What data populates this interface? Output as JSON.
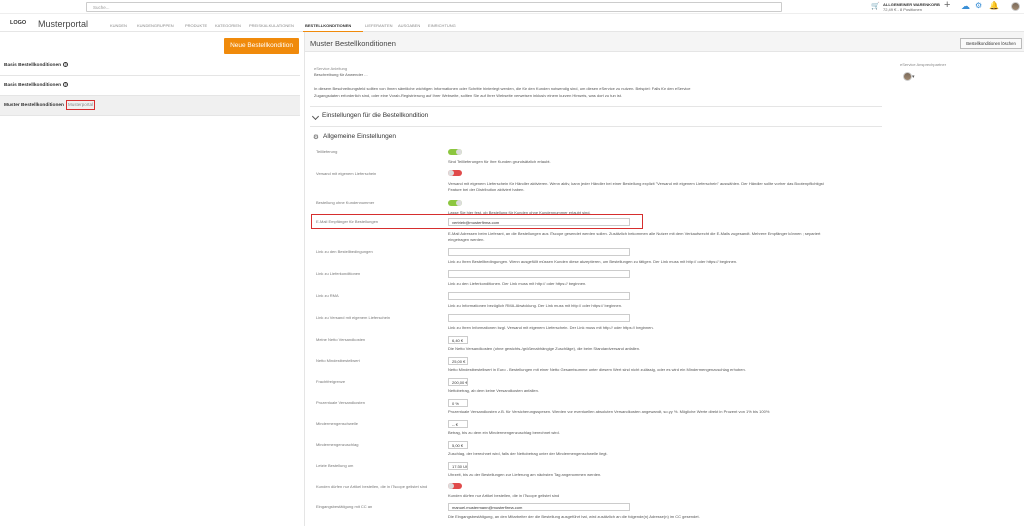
{
  "search": {
    "placeholder": "Suche..."
  },
  "cart": {
    "title": "ALLGEMEINER WARENKORB",
    "summary": "72,49 € - 8 Positionen"
  },
  "icons": {
    "cart": "cart-icon",
    "plus": "plus-icon",
    "bell": "bell-icon",
    "cloud": "cloud-icon"
  },
  "brand": {
    "logo": "LOGO",
    "portal": "Musterportal",
    "accent": "#f08a0b"
  },
  "nav": [
    "KUNDEN",
    "KUNDENGRUPPEN",
    "PRODUKTE",
    "KATEGORIEN",
    "PREISKALKULATIONEN",
    "BESTELLKONDITIONEN",
    "LIEFERANTEN",
    "AUSGABEN",
    "EINRICHTUNG"
  ],
  "left": {
    "new_button": "Neue Bestellkondition",
    "items": [
      {
        "label": "Basis Bestellkonditionen"
      },
      {
        "label": "Basis Bestellkonditionen"
      },
      {
        "label": "Muster Bestellkonditionen",
        "tag": "Musterportal"
      }
    ]
  },
  "right": {
    "title": "Muster Bestellkonditionen",
    "delete_button": "Bestellkonditionen löschen",
    "guide_label": "eService Anleitung",
    "guide_text": "Beschreibung für Anwender ...",
    "partner_label": "eService Ansprechpartner",
    "intro1": "In diesem Beschreibungsfeld sollten von Ihnen sämtliche wichtigen Informationen oder Schritte hinterlegt werden, die für den Kunden notwendig sind, um diesen eService zu nutzen. Beispiel: Falls für den eService",
    "intro2": "Zugangsdaten erforderlich sind, oder eine Vorab-Registrierung auf Ihrer Webseite, sollten Sie auf Ihrer Webseite verweisen inklusiv einem kurzen Hinweis, was dort zu tun ist.",
    "section": "Einstellungen für die Bestellkondition",
    "subsection": "Allgemeine Einstellungen"
  },
  "fields": {
    "teil_label": "Teillieferung",
    "teil_hint": "Sind Teillieferungen für Ihre Kunden grundsätzlich erlaubt.",
    "vers_label": "Versand mit eigenem Lieferschein",
    "vers_hint1": "Versand mit eigenem Lieferschein für Händler aktivieren. Wenn aktiv, kann jeder Händler bei einer Bestellung explizit \"Versand mit eigenem Lieferschein\" auswählen. Der Händler sollte vorher das Bootenpflichtigst",
    "vers_hint2": "Feature bei der Distribution aktiviert haben.",
    "ohne_label": "Bestellung ohne Kundennummer",
    "ohne_hint": "Lasse Sie hier fest, ob Bestellung für Kunden ohne Kundennummer erlaubt sind.",
    "mail_label": "E-Mail Empfänger für Bestellungen",
    "mail_value": "vertrieb@musterfirma.com",
    "mail_hint1": "E-Mail Adressen beim Lieferant, an die Bestellungen aus ITscope gesendet werden sollen. Zusätzlich bekommen alle Nutzer mit dem Verkaufsrecht die E-Mails zugesandt. Mehrere Empfänger können ; separiert",
    "mail_hint2": "eingetragen werden.",
    "link1_label": "Link zu den Bestellbedingungen",
    "link1_hint": "Link zu Ihren Bestellbedingungen. Wenn ausgefüllt müssen Kunden diese akzeptieren, um Bestellungen zu tätigen. Der Link muss mit http:// oder https:// beginnen.",
    "link2_label": "Link zu Lieferkonditionen",
    "link2_hint": "Link zu den Lieferkonditionen. Der Link muss mit http:// oder https:// beginnen.",
    "link3_label": "Link zu RMA",
    "link3_hint": "Link zu Informationen bezüglich RMA-Abwicklung. Der Link muss mit http:// oder https:// beginnen.",
    "link4_label": "Link zu Versand mit eigenem Lieferschein",
    "link4_hint": "Link zu Ihren Informationen bzgl. Versand mit eigenem Lieferschein. Der Link muss mit http:// oder https:// beginnen.",
    "netto_label": "Meine Netto Versandkosten",
    "netto_value": "6,40 €",
    "netto_hint": "Die Netto Versandkosten (ohne gewichts-/größenabhängige Zuschläge), die beim Standardversand anfallen.",
    "min_label": "Netto Mindestbestellwert",
    "min_value": "25,00 €",
    "min_hint": "Netto Mindestbestellwert in Euro - Bestellungen mit einer Netto Gesamtsumme unter diesem Wert sind nicht zulässig, oder es wird ein Mindermengenzuschlag erhoben.",
    "fracht_label": "Frachtfreigrenze",
    "fracht_value": "200,00 €",
    "fracht_hint": "Nettobetrag, ab dem keine Versandkosten anfallen.",
    "proz_label": "Prozentuale Versandkosten",
    "proz_value": "0 %",
    "proz_hint": "Prozentuale Versandkosten z.B. für Versicherungsspesen. Werden vor eventuellen absoluten Versandkosten angewandt, so.yy %. Mögliche Werte direkt in Prozent von 1% bis 100%",
    "mschw_label": "Mindermengenschwelle",
    "mschw_value": "-- €",
    "mschw_hint": "Betrag, bis zu dem ein Mindermengenzuschlag berechnet wird.",
    "mzus_label": "Mindermengenzuschlag",
    "mzus_value": "5,00 €",
    "mzus_hint": "Zuschlag, der berechnet wird, falls der Nettobetrag unter der Mindermengenschwelle liegt.",
    "letzte_label": "Letzte Bestellung um",
    "letzte_value": "17:30 Uhr",
    "letzte_hint": "Uhrzeit, bis zu der Bestellungen zur Lieferung am nächsten Tag angenommen werden.",
    "nur_label": "Kunden dürfen nur Artikel bestellen, die in ITscope gelistet sind",
    "nur_hint": "Kunden dürfen nur Artikel bestellen, die in ITscope gelistet sind",
    "cc_label": "Eingangsbestätigung mit CC an",
    "cc_value": "manuel.mustermann@musterfirma.com",
    "cc_hint": "Die Eingangsbestätigung, an den Mitarbeiter der die Bestellung ausgeführt hat, wird zusätzlich an die folgende(n) Adresse(n) im CC gesendet."
  }
}
